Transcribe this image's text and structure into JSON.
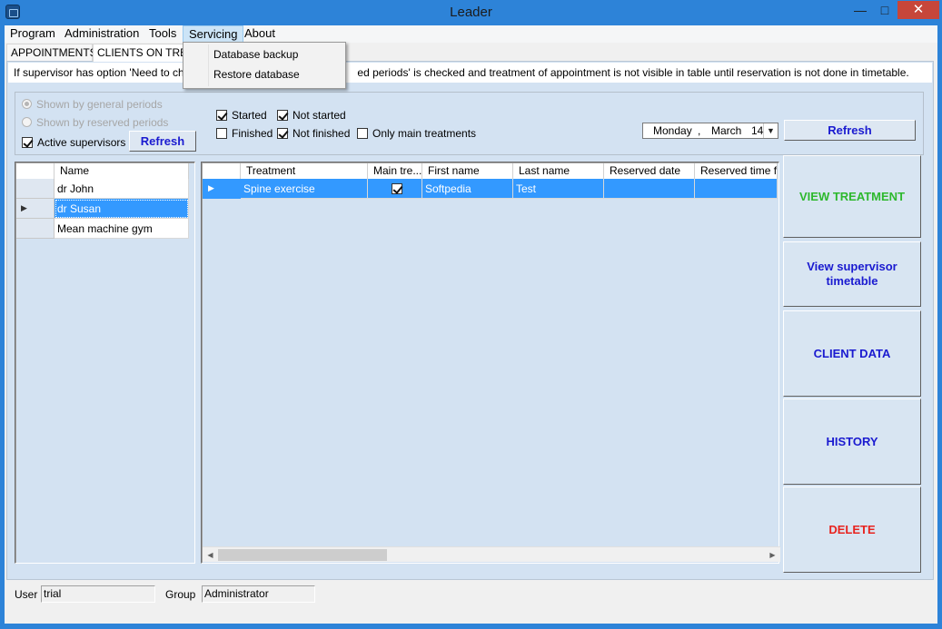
{
  "window": {
    "title": "Leader",
    "min_icon": "minimize-icon",
    "max_icon": "maximize-icon",
    "close_icon": "close-icon"
  },
  "menu": {
    "program": "Program",
    "administration": "Administration",
    "tools": "Tools",
    "servicing": "Servicing",
    "about": "About"
  },
  "servicing_menu": {
    "backup": "Database backup",
    "restore": "Restore database"
  },
  "tabs": {
    "appointments": "APPOINTMENTS",
    "clients": "CLIENTS ON TREA"
  },
  "info": {
    "left": "If supervisor has  option 'Need to chec",
    "right": "ed periods' is checked and treatment of appointment is not visible in table until reservation is not done in timetable."
  },
  "filters": {
    "general_periods": "Shown by general periods",
    "reserved_periods": "Shown by reserved periods",
    "active_supervisors": "Active supervisors",
    "refresh_left": "Refresh",
    "started": "Started",
    "not_started": "Not started",
    "finished": "Finished",
    "not_finished": "Not finished",
    "only_main": "Only main treatments",
    "date_day": "Monday",
    "date_sep": ",",
    "date_month": "March",
    "date_num": "14",
    "refresh_right": "Refresh"
  },
  "supervisors": {
    "header": "Name",
    "rows": [
      "dr John",
      "dr Susan",
      "Mean machine gym"
    ]
  },
  "treatments": {
    "headers": [
      "Treatment",
      "Main tre...",
      "First name",
      "Last name",
      "Reserved date",
      "Reserved time fr..."
    ],
    "row": {
      "treatment": "Spine exercise",
      "main": true,
      "first_name": "Softpedia",
      "last_name": "Test",
      "reserved_date": "",
      "reserved_time": ""
    }
  },
  "actions": {
    "view_treatment": "VIEW TREATMENT",
    "view_timetable": "View supervisor timetable",
    "client_data": "CLIENT DATA",
    "history": "HISTORY",
    "delete": "DELETE"
  },
  "colors": {
    "view_treatment": "#2db82d",
    "blue": "#1a1ad0",
    "delete": "#e8231f",
    "selection": "#3399ff"
  },
  "status": {
    "user_label": "User",
    "user_value": "trial",
    "group_label": "Group",
    "group_value": "Administrator"
  }
}
